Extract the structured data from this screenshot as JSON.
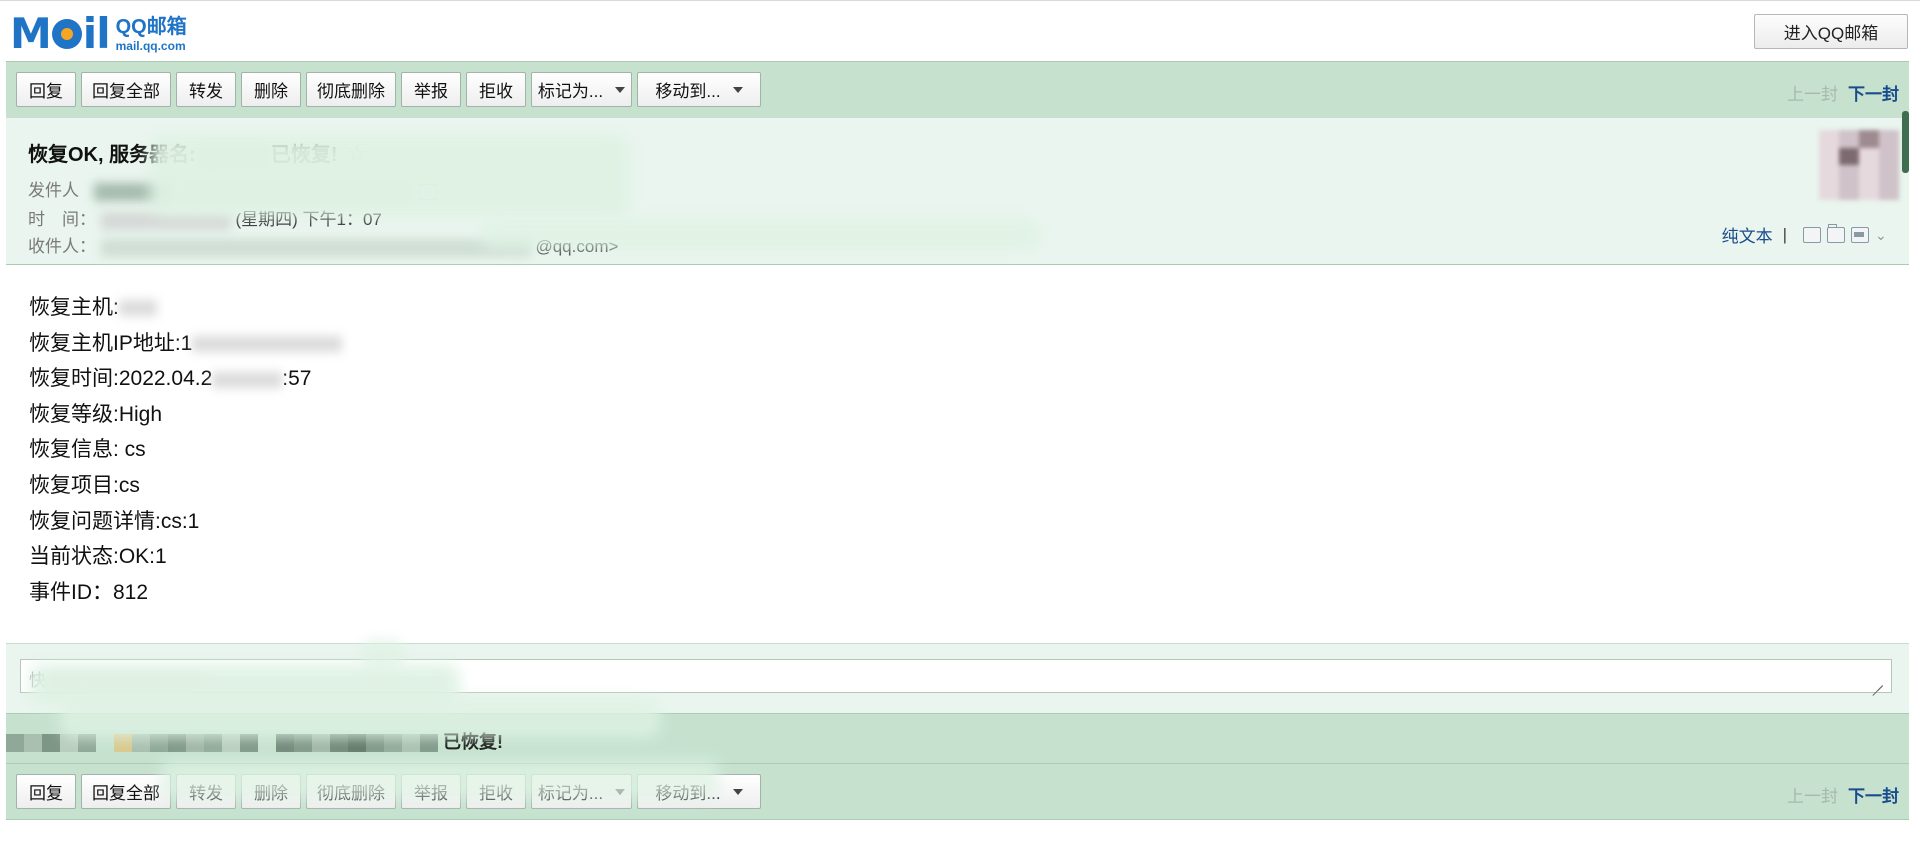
{
  "brand": {
    "logo_text": "MOIL",
    "product_name": "QQ邮箱",
    "domain": "mail.qq.com"
  },
  "header": {
    "enter_button": "进入QQ邮箱"
  },
  "toolbar": {
    "reply": "回复",
    "reply_all": "回复全部",
    "forward": "转发",
    "delete": "删除",
    "delete_permanently": "彻底删除",
    "report": "举报",
    "reject": "拒收",
    "mark_as": "标记为...",
    "move_to": "移动到...",
    "prev": "上一封",
    "next": "下一封"
  },
  "mail": {
    "subject_prefix": "恢复OK, 服务器名:",
    "subject_suffix": "已恢复!",
    "star_icon": "☆",
    "sender_label": "发件人",
    "time_label": "时　间：",
    "time_value": "(星期四) 下午1：07",
    "recipient_label": "收件人：",
    "recipient_email_tail": "@qq.com>",
    "plain_text": "纯文本",
    "actions_separator": "|",
    "icons": [
      "note-icon",
      "folder-icon",
      "print-icon",
      "chevron-down-icon"
    ]
  },
  "body_lines": [
    "恢复主机:",
    "恢复主机IP地址:1",
    "恢复时间:2022.04.2",
    "恢复等级:High",
    "恢复信息: cs",
    "恢复项目:cs",
    "恢复问题详情:cs:1",
    "当前状态:OK:1",
    "事件ID：812"
  ],
  "body_time_tail": ":57",
  "reply_box": {
    "placeholder": "快"
  },
  "bottom_strip": {
    "subject_tail": "已恢复!"
  },
  "colors": {
    "toolbar_bg": "#c6e2cf",
    "header_bg": "#e9f5ee",
    "link": "#1a4b8c",
    "brand": "#1f74c6"
  }
}
